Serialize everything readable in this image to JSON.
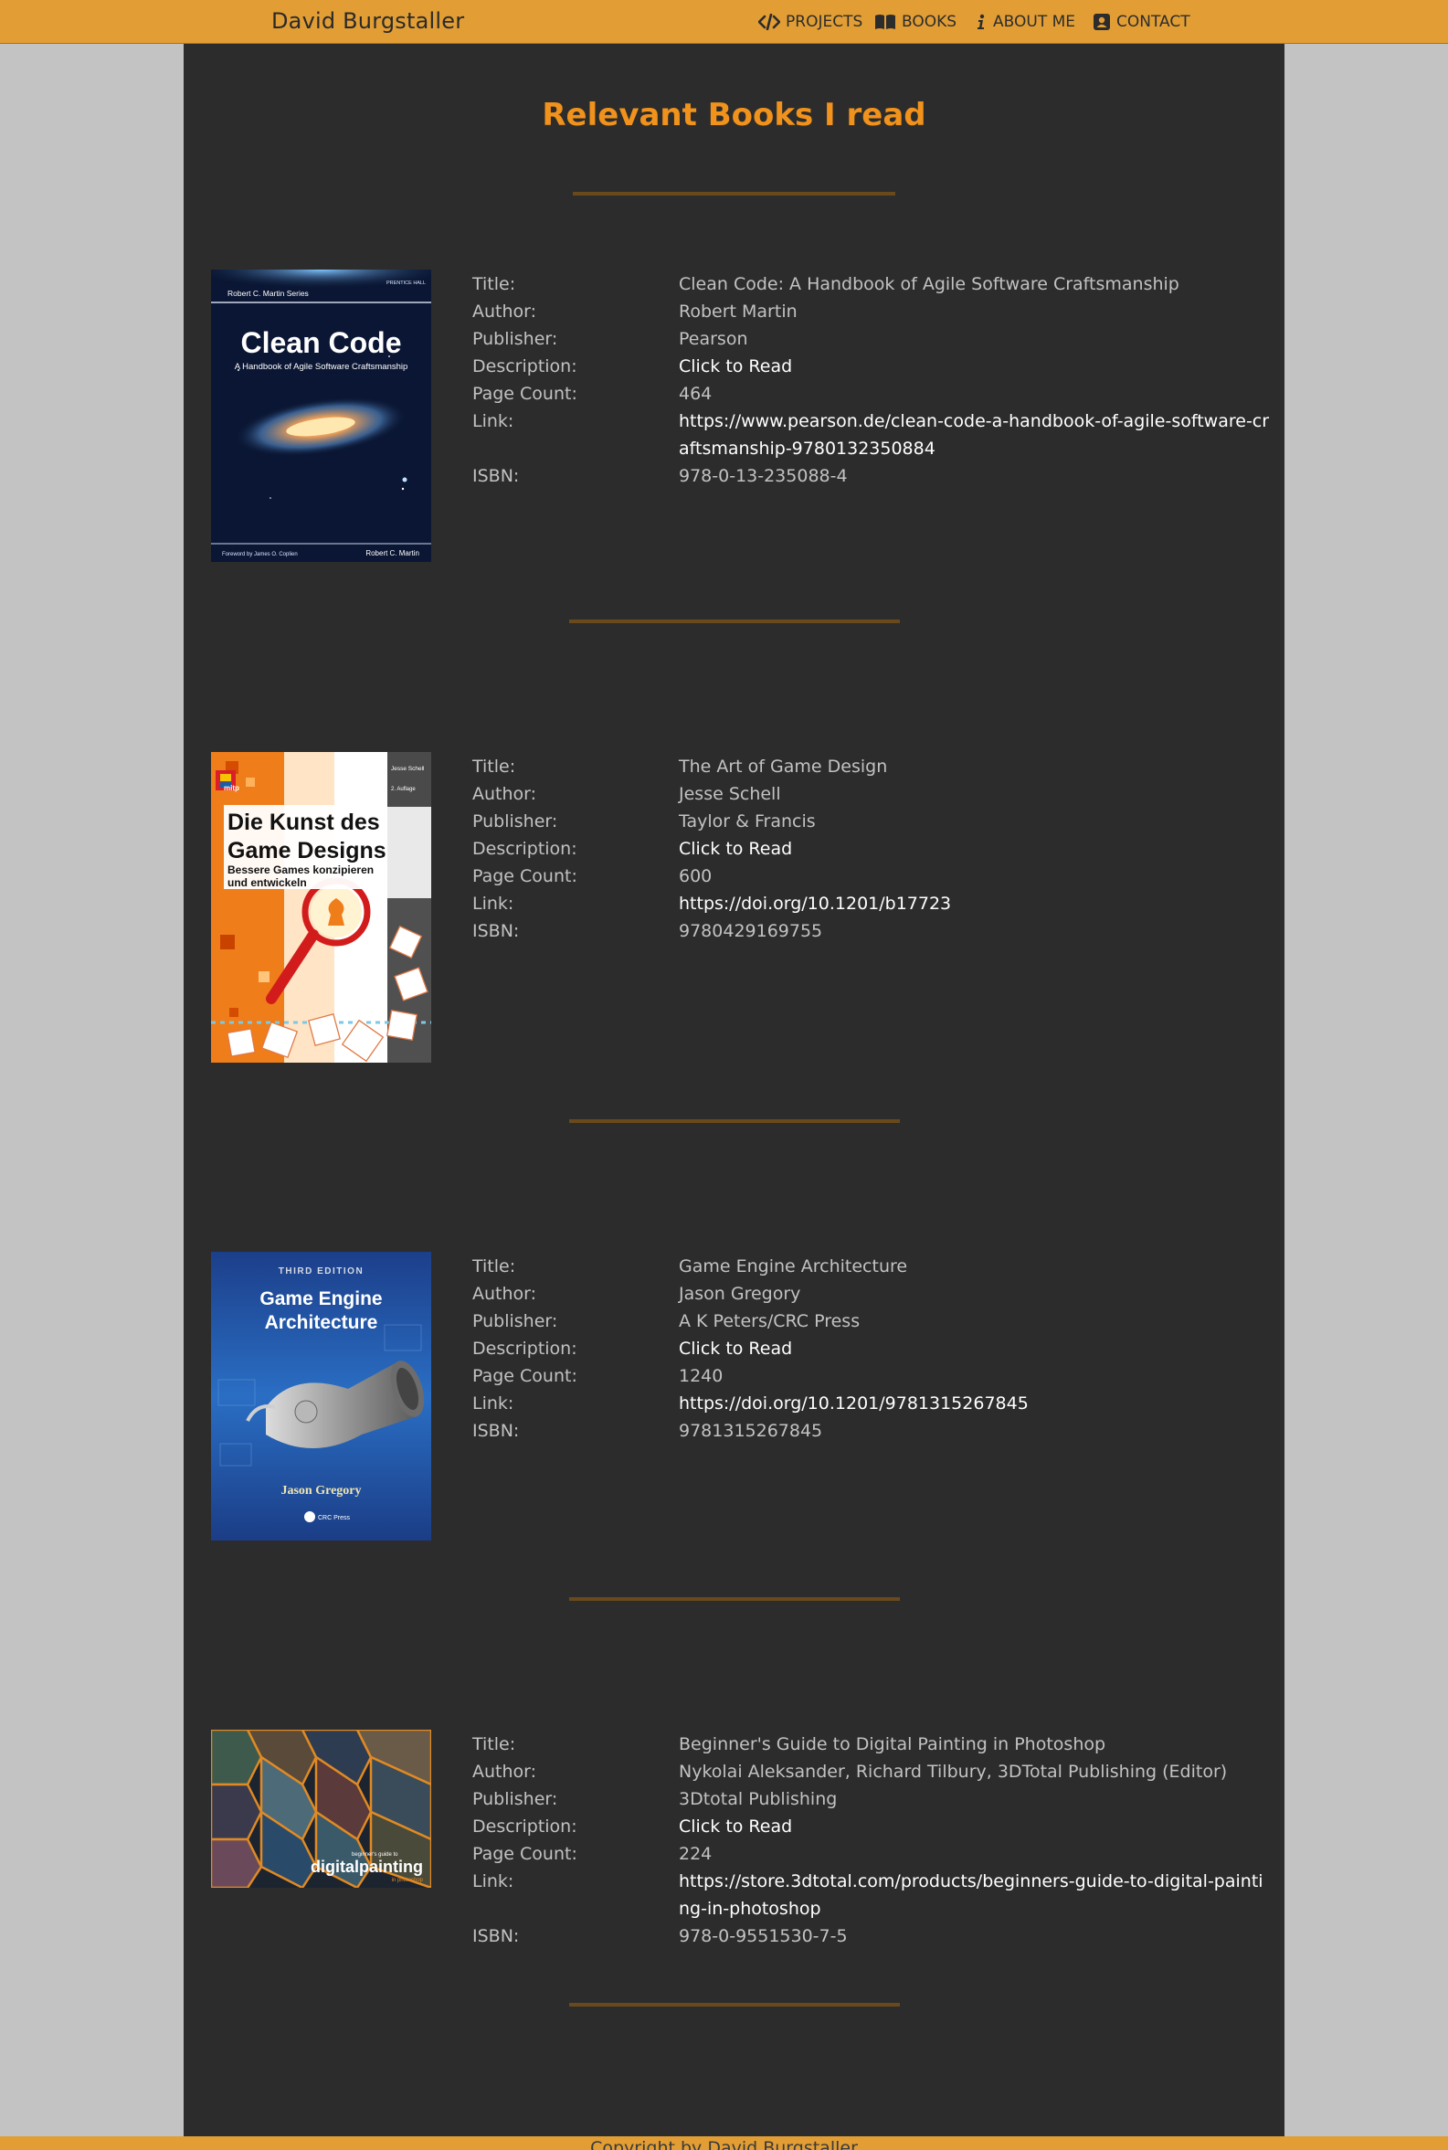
{
  "nav": {
    "brand": "David Burgstaller",
    "items": [
      {
        "label": "PROJECTS",
        "icon": "code-icon"
      },
      {
        "label": "BOOKS",
        "icon": "book-icon"
      },
      {
        "label": "ABOUT ME",
        "icon": "info-icon"
      },
      {
        "label": "CONTACT",
        "icon": "contact-card-icon"
      }
    ]
  },
  "page": {
    "title": "Relevant Books I read"
  },
  "labels": {
    "title": "Title:",
    "author": "Author:",
    "publisher": "Publisher:",
    "description": "Description:",
    "page_count": "Page Count:",
    "link": "Link:",
    "isbn": "ISBN:"
  },
  "books": [
    {
      "title": "Clean Code: A Handbook of Agile Software Craftsmanship",
      "author": "Robert Martin",
      "publisher": "Pearson",
      "description": "Click to Read",
      "page_count": "464",
      "link": "https://www.pearson.de/clean-code-a-handbook-of-agile-software-craftsmanship-9780132350884",
      "isbn": "978-0-13-235088-4",
      "cover": {
        "series": "Robert C. Martin Series",
        "imprint": "PRENTICE HALL",
        "title": "Clean Code",
        "subtitle": "A Handbook of Agile Software Craftsmanship",
        "foreword": "Foreword by James O. Coplien",
        "author": "Robert C. Martin"
      }
    },
    {
      "title": "The Art of Game Design",
      "author": "Jesse Schell",
      "publisher": "Taylor & Francis",
      "description": "Click to Read",
      "page_count": "600",
      "link": "https://doi.org/10.1201/b17723",
      "isbn": "9780429169755",
      "cover": {
        "publisher_logo": "mitp",
        "author": "Jesse Schell",
        "edition": "2. Auflage",
        "title_line1": "Die Kunst des",
        "title_line2": "Game Designs",
        "subtitle_line1": "Bessere Games konzipieren",
        "subtitle_line2": "und entwickeln"
      }
    },
    {
      "title": "Game Engine Architecture",
      "author": "Jason Gregory",
      "publisher": "A K Peters/CRC Press",
      "description": "Click to Read",
      "page_count": "1240",
      "link": "https://doi.org/10.1201/9781315267845",
      "isbn": "9781315267845",
      "cover": {
        "edition": "THIRD EDITION",
        "title_line1": "Game Engine",
        "title_line2": "Architecture",
        "author": "Jason Gregory",
        "publisher": "CRC Press"
      }
    },
    {
      "title": "Beginner's Guide to Digital Painting in Photoshop",
      "author": "Nykolai Aleksander, Richard Tilbury, 3DTotal Publishing (Editor)",
      "publisher": "3Dtotal Publishing",
      "description": "Click to Read",
      "page_count": "224",
      "link": "https://store.3dtotal.com/products/beginners-guide-to-digital-painting-in-photoshop",
      "isbn": "978-0-9551530-7-5",
      "cover": {
        "small": "beginner's guide to",
        "title": "digitalpainting",
        "sub": "in photoshop"
      }
    }
  ],
  "footer": {
    "text": "Copyright by David Burgstaller"
  }
}
